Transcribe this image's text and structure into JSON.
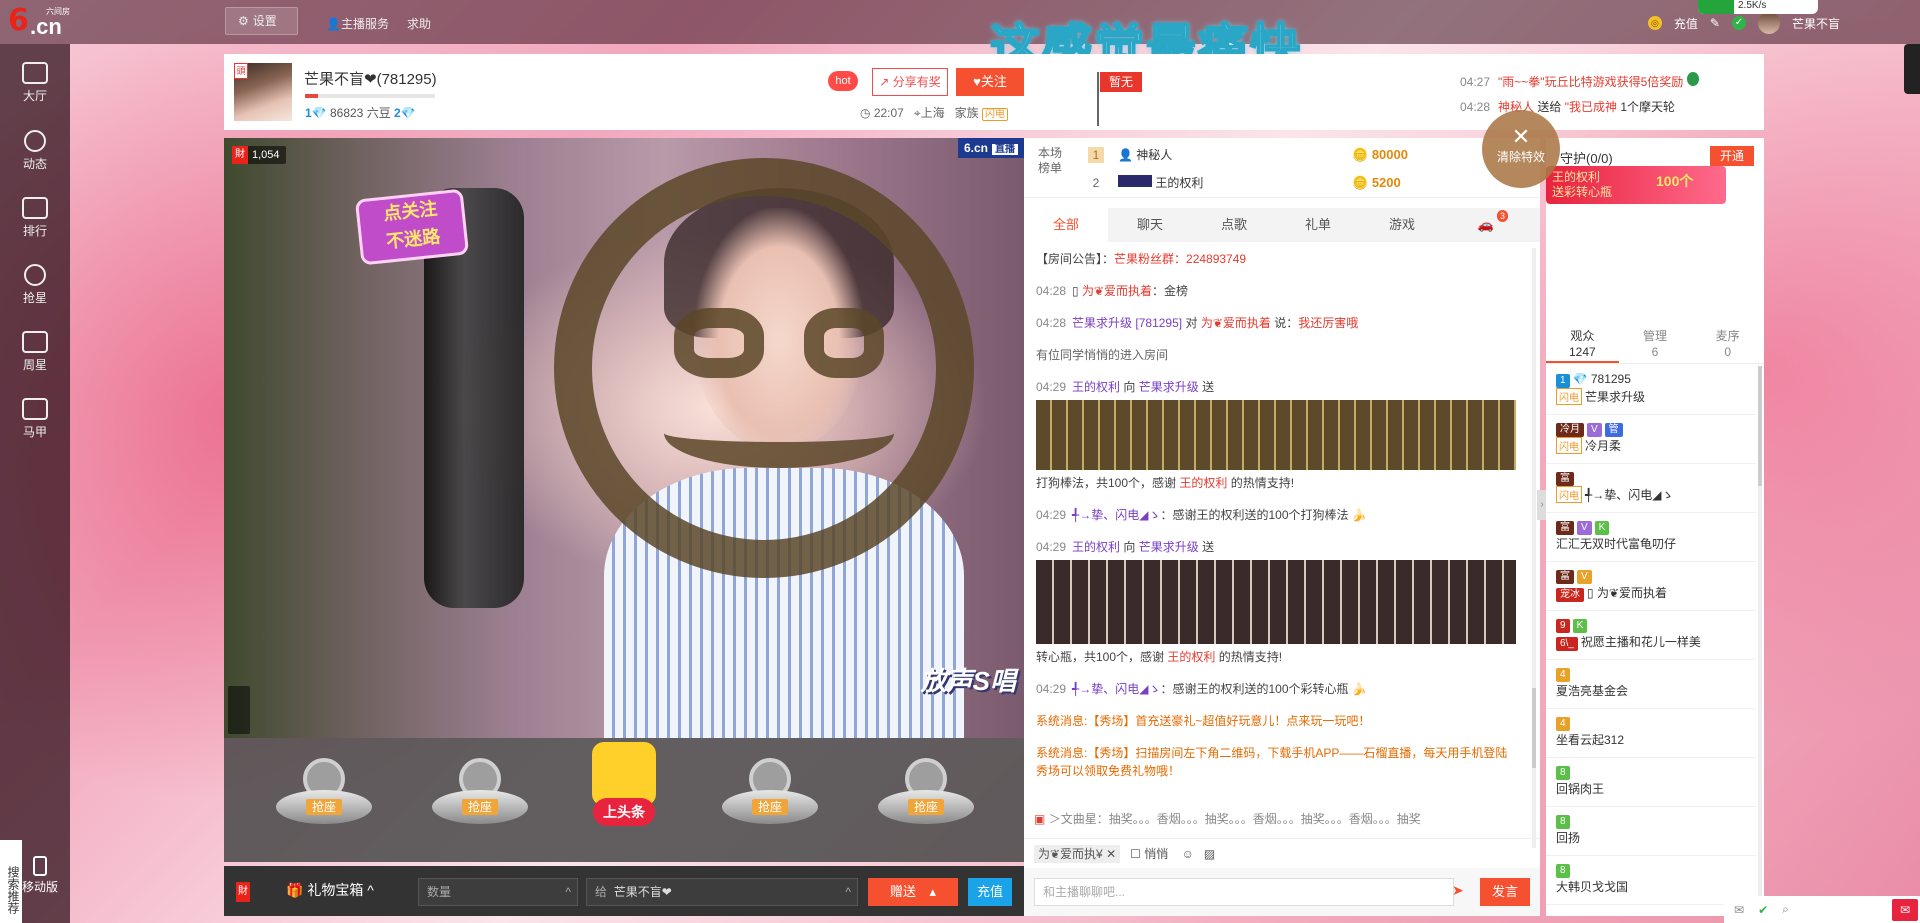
{
  "topbar": {
    "logo": "6.cn",
    "logo_sub": "六间房",
    "settings_label": "设置",
    "host_service_label": "主播服务",
    "help_label": "求助",
    "banner_text": "这感觉最痛快",
    "recharge_label": "充值",
    "user_name": "芒果不盲",
    "net_speed": "2.5K/s"
  },
  "sidebar": {
    "items": [
      {
        "label": "大厅",
        "icon": "tv-icon"
      },
      {
        "label": "动态",
        "icon": "compass-icon"
      },
      {
        "label": "排行",
        "icon": "crown-icon"
      },
      {
        "label": "抢星",
        "icon": "star-icon"
      },
      {
        "label": "周星",
        "icon": "gift-icon"
      },
      {
        "label": "马甲",
        "icon": "shirt-icon"
      }
    ],
    "search_rec": "搜索推荐",
    "mobile_label": "移动版"
  },
  "header": {
    "streamer_name": "芒果不盲❤(781295)",
    "level_left": "1",
    "beans": "86823 六豆",
    "level_right": "2",
    "level_progress": 0.1,
    "hot_label": "hot",
    "share_label": "分享有奖",
    "follow_label": "关注",
    "time": "22:07",
    "location": "上海",
    "family_label": "家族",
    "flash_label": "闪电",
    "pin_label": "暂无",
    "ticker": [
      {
        "time": "04:27",
        "text": "\"雨~~拳\"玩丘比特游戏获得5倍奖励"
      },
      {
        "time": "04:28",
        "user": "神秘人",
        "verb": "送给",
        "target": "\"我已成神",
        "gift": "1个摩天轮"
      }
    ]
  },
  "video": {
    "viewer_count": "1,054",
    "logo": "6.cn",
    "live_label": "直播",
    "sticker_line1": "点关注",
    "sticker_line2": "不迷路",
    "song_tag": "放声S唱"
  },
  "seats": {
    "seat_label": "抢座",
    "headline_label": "上头条"
  },
  "giftbar": {
    "gift_box_label": "礼物宝箱",
    "quantity_placeholder": "数量",
    "to_prefix": "给",
    "to_name": "芒果不盲❤",
    "send_label": "赠送",
    "recharge_label": "充值"
  },
  "rank": {
    "label": "本场榜单",
    "rows": [
      {
        "n": "1",
        "name": "神秘人",
        "value": "80000"
      },
      {
        "n": "2",
        "name": "王的权利",
        "value": "5200"
      }
    ]
  },
  "clear_effects_label": "清除特效",
  "chat_tabs": [
    "全部",
    "聊天",
    "点歌",
    "礼单",
    "游戏"
  ],
  "car_badge": "3",
  "chat": {
    "announcement_label": "【房间公告】：",
    "announcement_text": "芒果粉丝群：224893749",
    "messages": [
      {
        "time": "04:28",
        "user": "为❦爱而执着",
        "text": "：金榜"
      },
      {
        "time": "04:28",
        "user": "芒果求升级",
        "id": "[781295]",
        "verb": "对",
        "target": "为❦爱而执着",
        "say": "说：",
        "text": "我还厉害哦"
      },
      {
        "text": "有位同学悄悄的进入房间"
      },
      {
        "time": "04:29",
        "user": "王的权利",
        "verb": "向",
        "target": "芒果求升级",
        "act": "送",
        "tail": "打狗棒法，共100个，感谢",
        "thanks_user": "王的权利",
        "thanks_tail": "的热情支持!"
      },
      {
        "time": "04:29",
        "user": "╃→挚、闪电◢ゝ",
        "text": "：感谢王的权利送的100个打狗棒法"
      },
      {
        "time": "04:29",
        "user": "王的权利",
        "verb": "向",
        "target": "芒果求升级",
        "act": "送",
        "tail": "转心瓶，共100个，感谢",
        "thanks_user": "王的权利",
        "thanks_tail": "的热情支持!"
      },
      {
        "time": "04:29",
        "user": "╃→挚、闪电◢ゝ",
        "text": "：感谢王的权利送的100个彩转心瓶"
      }
    ],
    "system": [
      "系统消息:【秀场】首充送豪礼~超值好玩意儿！点来玩一玩吧！",
      "系统消息:【秀场】扫描房间左下角二维码，下载手机APP——石榴直播，每天用手机登陆秀场可以领取免费礼物哦！"
    ],
    "marquee": "＞文曲星：抽奖。。。香烟。。。抽奖。。。香烟。。。抽奖。。。香烟。。。抽奖",
    "target_chip": "为❦爱而执¥",
    "whisper_label": "悄悄",
    "input_placeholder": "和主播聊聊吧...",
    "say_label": "发言"
  },
  "guard": {
    "title": "守护(0/0)",
    "open_label": "开通",
    "banner_line1": "王的权利",
    "banner_line2": "送彩转心瓶",
    "banner_count": "100个"
  },
  "audience_tabs": [
    {
      "label": "观众",
      "count": "1247"
    },
    {
      "label": "管理",
      "count": "6"
    },
    {
      "label": "麦序",
      "count": "0"
    }
  ],
  "audience": [
    {
      "lv": "1",
      "extra": "781295",
      "name": "芒果求升级",
      "flash": true
    },
    {
      "lv": "冷月",
      "name": "冷月柔",
      "badges": [
        "V",
        "管"
      ]
    },
    {
      "lv": "富",
      "name": "╃→挚、闪电◢ゝ",
      "flash": true
    },
    {
      "lv": "富",
      "name": "汇汇无双时代富龟叨仔",
      "badges": [
        "V",
        "K"
      ]
    },
    {
      "lv": "富",
      "name": "为❦爱而执着",
      "badges": [
        "V"
      ],
      "tag": "宠冰"
    },
    {
      "lv": "9",
      "name": "祝愿主播和花儿一样美",
      "badges": [
        "K"
      ],
      "tag": "6\\_"
    },
    {
      "lv": "4",
      "name": "夏浩亮基金会"
    },
    {
      "lv": "4",
      "name": "坐看云起312"
    },
    {
      "lv": "8",
      "name": "回锅肉王"
    },
    {
      "lv": "8",
      "name": "回扬"
    },
    {
      "lv": "8",
      "name": "大韩贝戈戈国"
    }
  ]
}
